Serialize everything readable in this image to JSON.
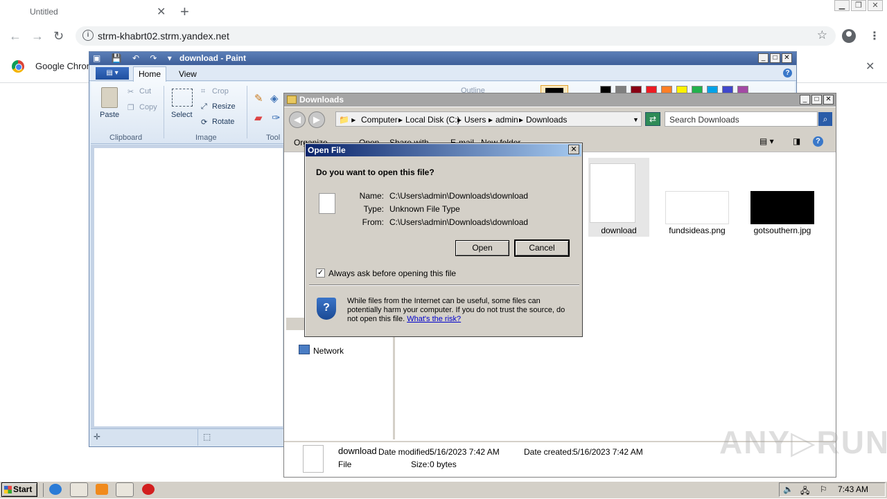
{
  "chrome": {
    "tab_title": "Untitled",
    "url": "strm-khabrt02.strm.yandex.net",
    "infobar_text": "Google Chrom"
  },
  "paint": {
    "title": "download - Paint",
    "tabs": [
      "Home",
      "View"
    ],
    "clipboard": {
      "paste": "Paste",
      "cut": "Cut",
      "copy": "Copy",
      "group": "Clipboard"
    },
    "image": {
      "select": "Select",
      "crop": "Crop",
      "resize": "Resize",
      "rotate": "Rotate",
      "group": "Image"
    },
    "tools_group": "Tool",
    "outline": "Outline",
    "palette": [
      "#000000",
      "#7f7f7f",
      "#880015",
      "#ed1c24",
      "#ff7f27",
      "#fff200",
      "#22b14c",
      "#00a2e8",
      "#3f48cc",
      "#a349a4"
    ]
  },
  "explorer": {
    "title": "Downloads",
    "breadcrumbs": [
      "Computer",
      "Local Disk (C:)",
      "Users",
      "admin",
      "Downloads"
    ],
    "search_placeholder": "Search Downloads",
    "commands": [
      "Organize",
      "Open",
      "Share with",
      "E-mail",
      "New folder"
    ],
    "nav_network": "Network",
    "files": [
      {
        "name": "download"
      },
      {
        "name": "fundsideas.png"
      },
      {
        "name": "gotsouthern.jpg"
      }
    ],
    "details": {
      "name": "download",
      "type": "File",
      "modified_label": "Date modified:",
      "modified": "5/16/2023 7:42 AM",
      "created_label": "Date created:",
      "created": "5/16/2023 7:42 AM",
      "size_label": "Size:",
      "size": "0 bytes"
    }
  },
  "dialog": {
    "title": "Open File",
    "question": "Do you want to open this file?",
    "name_label": "Name:",
    "name": "C:\\Users\\admin\\Downloads\\download",
    "type_label": "Type:",
    "type": "Unknown File Type",
    "from_label": "From:",
    "from": "C:\\Users\\admin\\Downloads\\download",
    "open_button": "Open",
    "cancel_button": "Cancel",
    "checkbox_label": "Always ask before opening this file",
    "checkbox_checked": true,
    "warning": "While files from the Internet can be useful, some files can potentially harm your computer. If you do not trust the source, do not open this file.",
    "risk_link": "What's the risk?"
  },
  "taskbar": {
    "start": "Start",
    "clock": "7:43 AM"
  },
  "watermark": "ANY RUN"
}
